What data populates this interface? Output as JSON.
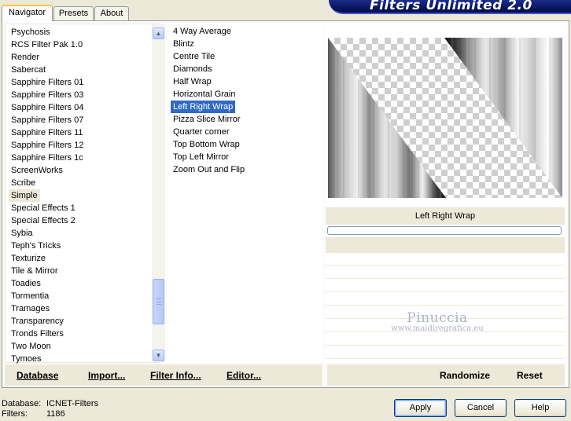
{
  "tabs": [
    {
      "label": "Navigator",
      "active": true
    },
    {
      "label": "Presets",
      "active": false
    },
    {
      "label": "About",
      "active": false
    }
  ],
  "title": "Filters Unlimited 2.0",
  "categories": {
    "items": [
      "Psychosis",
      "RCS Filter Pak 1.0",
      "Render",
      "Sabercat",
      "Sapphire Filters 01",
      "Sapphire Filters 03",
      "Sapphire Filters 04",
      "Sapphire Filters 07",
      "Sapphire Filters 11",
      "Sapphire Filters 12",
      "Sapphire Filters 1c",
      "ScreenWorks",
      "Scribe",
      "Simple",
      "Special Effects 1",
      "Special Effects 2",
      "Sybia",
      "Teph's Tricks",
      "Texturize",
      "Tile & Mirror",
      "Toadies",
      "Tormentia",
      "Tramages",
      "Transparency",
      "Tronds Filters",
      "Two Moon",
      "Tymoes"
    ],
    "selected": "Simple",
    "scroll_position": 0.78
  },
  "filters": {
    "items": [
      "4 Way Average",
      "Blintz",
      "Centre Tile",
      "Diamonds",
      "Half Wrap",
      "Horizontal Grain",
      "Left Right Wrap",
      "Pizza Slice Mirror",
      "Quarter corner",
      "Top Bottom Wrap",
      "Top Left Mirror",
      "Zoom Out and Flip"
    ],
    "selected": "Left Right Wrap"
  },
  "preview": {
    "filter_name": "Left Right Wrap",
    "watermark_title": "Pinuccia",
    "watermark_url": "www.maidiregrafica.eu"
  },
  "left_buttons": {
    "database": "Database",
    "import": "Import...",
    "filter_info": "Filter Info...",
    "editor": "Editor..."
  },
  "right_buttons": {
    "randomize": "Randomize",
    "reset": "Reset"
  },
  "status": {
    "database_label": "Database:",
    "database_value": "ICNET-Filters",
    "filters_label": "Filters:",
    "filters_value": "1186"
  },
  "dialog_buttons": {
    "apply": "Apply",
    "cancel": "Cancel",
    "help": "Help"
  },
  "colors": {
    "selection": "#316ac5",
    "face": "#ece9d8",
    "banner": "#0a1660"
  }
}
